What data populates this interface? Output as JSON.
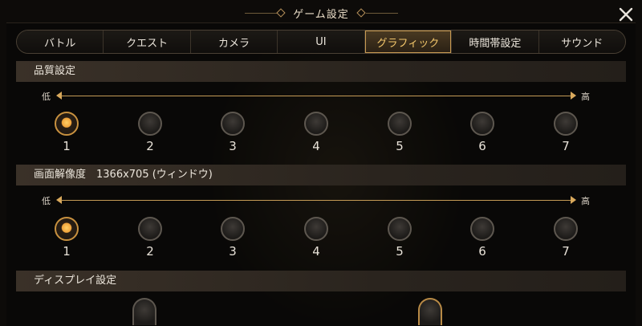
{
  "window": {
    "title": "ゲーム設定"
  },
  "tabs": [
    {
      "label": "バトル",
      "active": false
    },
    {
      "label": "クエスト",
      "active": false
    },
    {
      "label": "カメラ",
      "active": false
    },
    {
      "label": "UI",
      "active": false
    },
    {
      "label": "グラフィック",
      "active": true
    },
    {
      "label": "時間帯設定",
      "active": false
    },
    {
      "label": "サウンド",
      "active": false
    }
  ],
  "quality": {
    "header": "品質設定",
    "low_label": "低",
    "high_label": "高",
    "options": [
      "1",
      "2",
      "3",
      "4",
      "5",
      "6",
      "7"
    ],
    "selected": "1"
  },
  "resolution": {
    "header": "画面解像度　1366x705 (ウィンドウ)",
    "low_label": "低",
    "high_label": "高",
    "options": [
      "1",
      "2",
      "3",
      "4",
      "5",
      "6",
      "7"
    ],
    "selected": "1"
  },
  "display": {
    "header": "ディスプレイ設定"
  },
  "colors": {
    "accent": "#f3c76b",
    "selected_knob": "#f0a23a"
  },
  "icons": {
    "close": "close-icon"
  }
}
